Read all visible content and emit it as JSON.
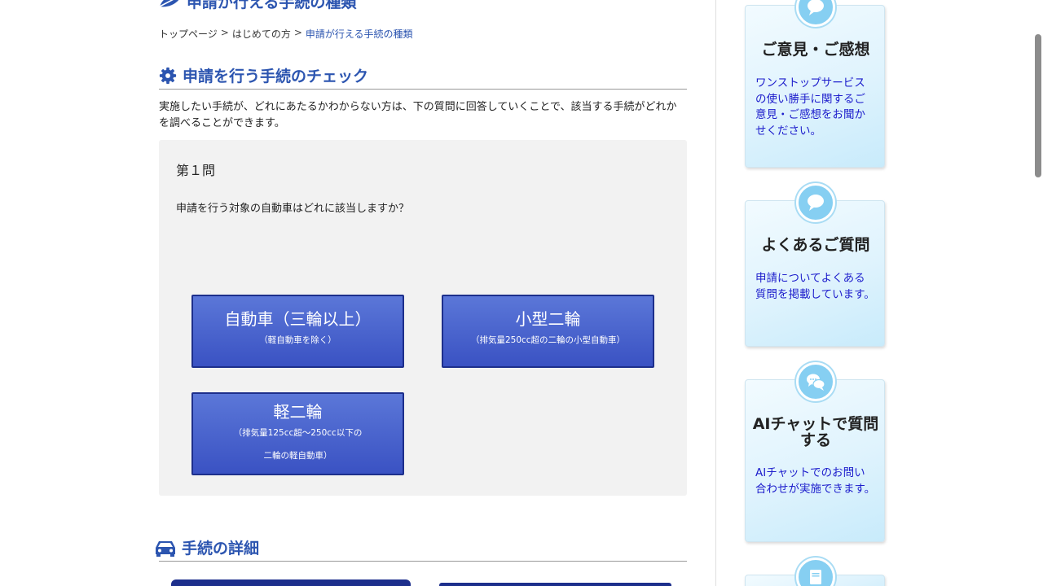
{
  "page_heading": "申請が行える手続の種類",
  "breadcrumb": {
    "items": [
      "トップページ",
      "はじめての方",
      "申請が行える手続の種類"
    ],
    "separator": ">"
  },
  "check_section": {
    "title": "申請を行う手続のチェック",
    "intro": "実施したい手続が、どれにあたるかわからない方は、下の質問に回答していくことで、該当する手続がどれかを調べることができます。",
    "question_number": "第１問",
    "question": "申請を行う対象の自動車はどれに該当しますか？",
    "choices": [
      {
        "label": "自動車（三輪以上）",
        "sub": "（軽自動車を除く）"
      },
      {
        "label": "小型二輪",
        "sub": "（排気量250cc超の二輪の小型自動車）"
      },
      {
        "label": "軽二輪",
        "sub1": "（排気量125cc超～250cc以下の",
        "sub2": "二輪の軽自動車）"
      }
    ]
  },
  "detail_section": {
    "title": "手続の詳細"
  },
  "sidebar": {
    "cards": [
      {
        "title": "ご意見・ご感想",
        "desc": "ワンストップサービスの使い勝手に関するご意見・ご感想をお聞かせください。",
        "icon": "speech-bubble-icon"
      },
      {
        "title": "よくあるご質問",
        "desc": "申請についてよくある質問を掲載しています。",
        "icon": "speech-bubble-icon"
      },
      {
        "title": "AIチャットで質問する",
        "desc": "AIチャットでのお問い合わせが実施できます。",
        "icon": "chat-bubbles-icon"
      },
      {
        "title": "",
        "desc": "",
        "icon": "book-icon"
      }
    ]
  },
  "colors": {
    "heading_blue": "#2c55b0",
    "button_blue": "#3a52c3",
    "button_border": "#1d2f8c",
    "link_blue": "#1d1dcc",
    "card_icon": "#86cff2"
  }
}
